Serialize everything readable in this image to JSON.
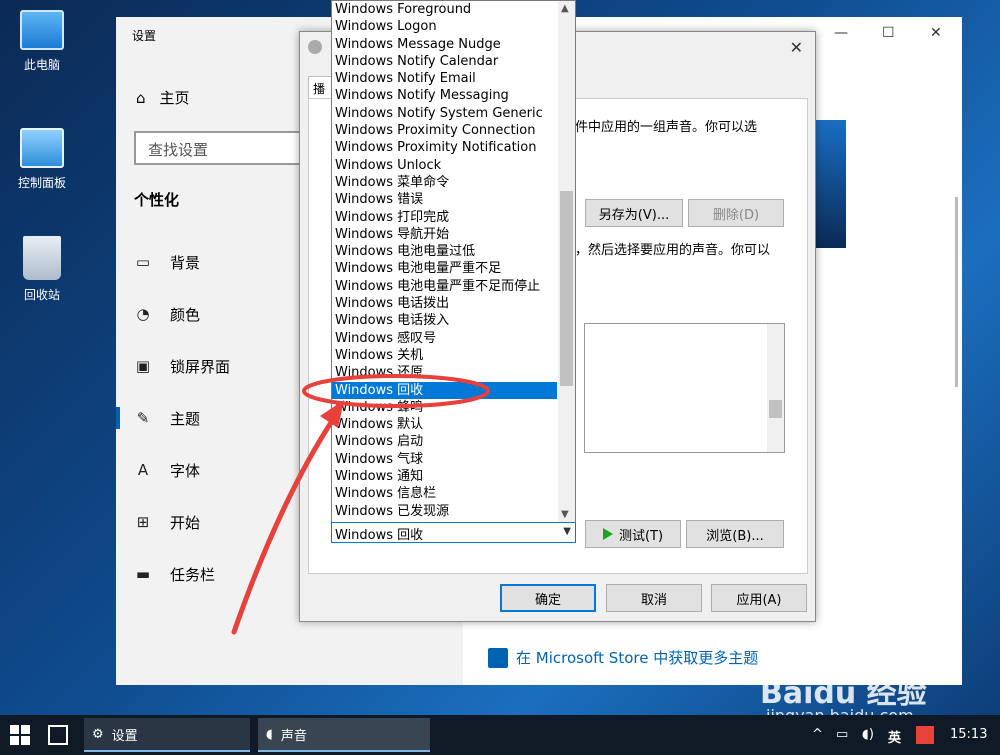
{
  "desktop": {
    "icons": [
      {
        "label": "此电脑"
      },
      {
        "label": "控制面板"
      },
      {
        "label": "回收站"
      }
    ]
  },
  "settings": {
    "window_title": "设置",
    "home_label": "主页",
    "search_placeholder": "查找设置",
    "section_title": "个性化",
    "nav": [
      {
        "label": "背景",
        "icon": "image-icon"
      },
      {
        "label": "颜色",
        "icon": "palette-icon"
      },
      {
        "label": "锁屏界面",
        "icon": "lock-screen-icon"
      },
      {
        "label": "主题",
        "icon": "theme-icon",
        "active": true
      },
      {
        "label": "字体",
        "icon": "font-icon"
      },
      {
        "label": "开始",
        "icon": "start-icon"
      },
      {
        "label": "任务栏",
        "icon": "taskbar-icon"
      }
    ],
    "store_link": "在 Microsoft Store 中获取更多主题"
  },
  "sound_dialog": {
    "tab_label": "播",
    "desc_line1": "事件中应用的一组声音。你可以选",
    "desc_line2": "牛，然后选择要应用的声音。你可以",
    "save_as_label": "另存为(V)...",
    "delete_label": "删除(D)",
    "test_label": "测试(T)",
    "browse_label": "浏览(B)...",
    "ok_label": "确定",
    "cancel_label": "取消",
    "apply_label": "应用(A)",
    "combo_value": "Windows 回收"
  },
  "sound_list": {
    "selected_index": 22,
    "items": [
      "Windows Foreground",
      "Windows Logon",
      "Windows Message Nudge",
      "Windows Notify Calendar",
      "Windows Notify Email",
      "Windows Notify Messaging",
      "Windows Notify System Generic",
      "Windows Proximity Connection",
      "Windows Proximity Notification",
      "Windows Unlock",
      "Windows 菜单命令",
      "Windows 错误",
      "Windows 打印完成",
      "Windows 导航开始",
      "Windows 电池电量过低",
      "Windows 电池电量严重不足",
      "Windows 电池电量严重不足而停止",
      "Windows 电话拨出",
      "Windows 电话拨入",
      "Windows 感叹号",
      "Windows 关机",
      "Windows 还原",
      "Windows 回收",
      "Windows 蜂鸣",
      "Windows 默认",
      "Windows 启动",
      "Windows 气球",
      "Windows 通知",
      "Windows 信息栏",
      "Windows 已发现源"
    ]
  },
  "taskbar": {
    "settings_label": "设置",
    "sound_label": "声音",
    "ime_label": "英",
    "time": "15:13"
  },
  "watermark": {
    "brand": "Baidu 经验",
    "url": "jingyan.baidu.com"
  },
  "colors": {
    "accent": "#0078d7",
    "annotation": "#e8413c"
  }
}
